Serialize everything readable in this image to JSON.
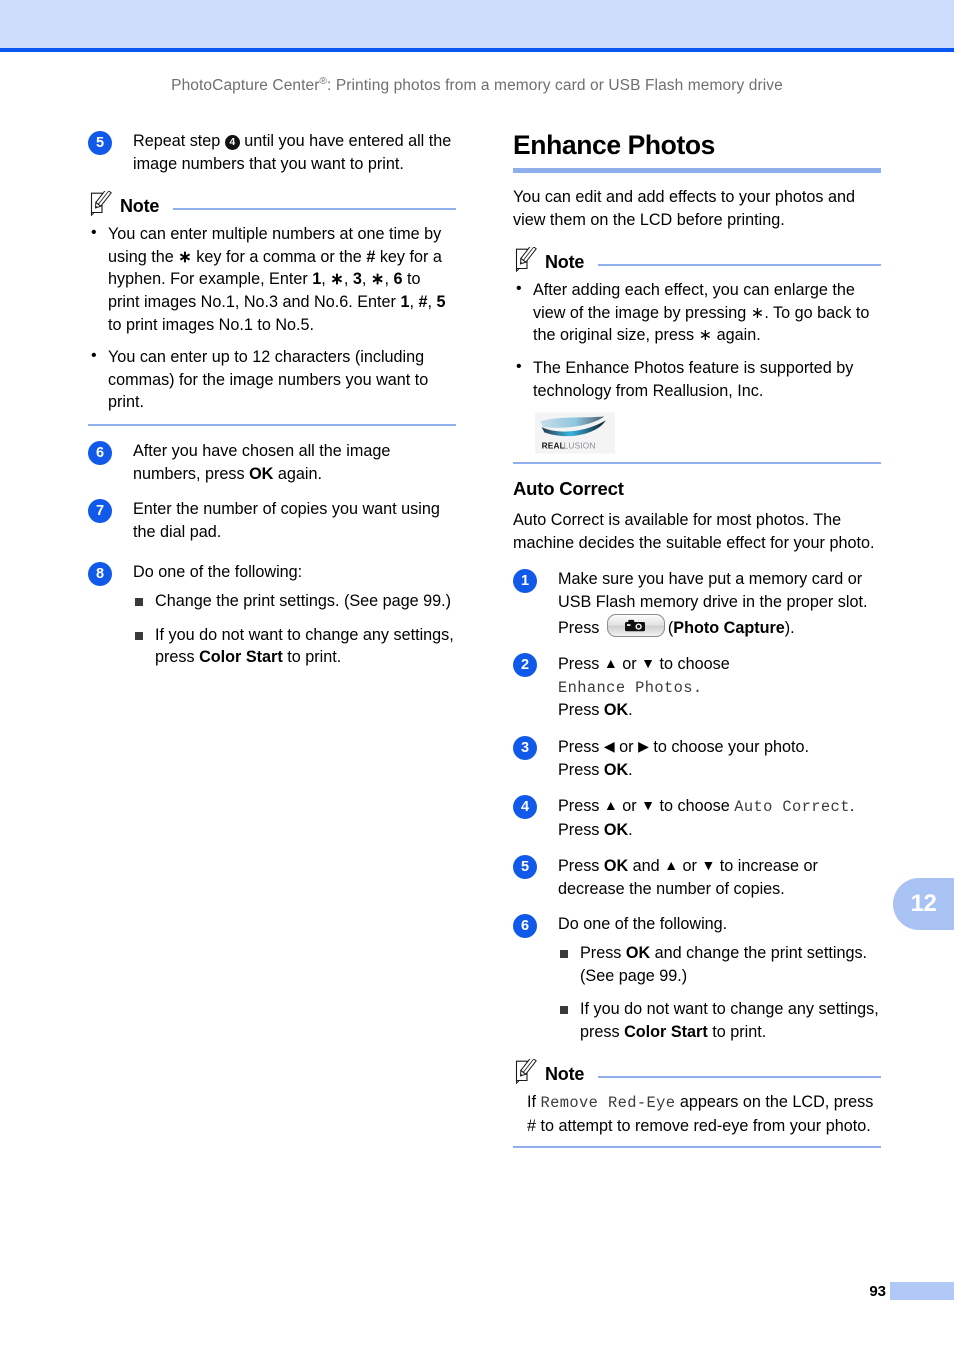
{
  "header": {
    "running_head_prefix": "PhotoCapture Center",
    "running_head_sup": "®",
    "running_head_suffix": ": Printing photos from a memory card or USB Flash memory drive"
  },
  "colors": {
    "band": "#cddcfb",
    "rule": "#0a56f0",
    "accent_rule": "#8fb0ec",
    "step_badge": "#1159e8",
    "chapter_tab": "#a8c2f4",
    "folio_bar": "#b2c8f7"
  },
  "left_column": {
    "step5": {
      "number": "5",
      "text_before": "Repeat step",
      "inline_badge": "4",
      "text_after": "until you have entered all the image numbers that you want to print."
    },
    "note1": {
      "title": "Note",
      "bullets": [
        {
          "p1": "You can enter multiple numbers at one time by using the ",
          "k1": "∗",
          "p2": " key for a comma or the ",
          "k2": "#",
          "p3": " key for a hyphen. For example, Enter ",
          "k3": "1",
          "p4": ", ",
          "k4": "∗",
          "p5": ", ",
          "k5": "3",
          "p6": ", ",
          "k6": "∗",
          "p7": ", ",
          "k7": "6",
          "p8": " to print images No.1, No.3 and No.6. Enter ",
          "k8": "1",
          "p9": ", ",
          "k9": "#",
          "p10": ", ",
          "k10": "5",
          "p11": " to print images No.1 to No.5."
        },
        {
          "text": "You can enter up to 12 characters (including commas) for the image numbers you want to print."
        }
      ]
    },
    "step6": {
      "number": "6",
      "text_before": "After you have chosen all the image numbers, press ",
      "bold": "OK",
      "text_after": " again."
    },
    "step7": {
      "number": "7",
      "text": "Enter the number of copies you want using the dial pad."
    },
    "step8": {
      "number": "8",
      "text": "Do one of the following:",
      "bullets": [
        {
          "text": "Change the print settings. (See page 99.)"
        },
        {
          "text_before": "If you do not want to change any settings, press ",
          "bold": "Color Start",
          "text_after": " to print."
        }
      ]
    }
  },
  "right_column": {
    "heading": "Enhance Photos",
    "intro": "You can edit and add effects to your photos and view them on the LCD before printing.",
    "note1": {
      "title": "Note",
      "bullets": [
        {
          "p1": "After adding each effect, you can enlarge the view of the image by pressing ",
          "k1": "∗",
          "p2": ". To go back to the original size, press ",
          "k2": "∗",
          "p3": " again."
        },
        {
          "text": "The Enhance Photos feature is supported by technology from Reallusion, Inc."
        }
      ],
      "logo": {
        "name": "reallusion-logo",
        "word_bold": "REAL",
        "word_light": "LUSION"
      }
    },
    "subheading": "Auto Correct",
    "sub_intro": "Auto Correct is available for most photos. The machine decides the suitable effect for your photo.",
    "step1": {
      "number": "1",
      "text": "Make sure you have put a memory card or USB Flash memory drive in the proper slot.",
      "press_label": "Press",
      "key_icon": "camera-icon",
      "key_caption_open": "(",
      "key_caption_bold": "Photo Capture",
      "key_caption_close": ")."
    },
    "step2": {
      "number": "2",
      "line1_before": "Press ",
      "up": "▲",
      "or": " or ",
      "down": "▼",
      "line1_after": " to choose",
      "lcd": "Enhance Photos.",
      "line3_before": "Press ",
      "line3_bold": "OK",
      "line3_after": "."
    },
    "step3": {
      "number": "3",
      "line1_before": "Press ",
      "left": "◀",
      "or": " or ",
      "right": "▶",
      "line1_after": " to choose your photo.",
      "line2_before": "Press ",
      "line2_bold": "OK",
      "line2_after": "."
    },
    "step4": {
      "number": "4",
      "line1_before": "Press ",
      "up": "▲",
      "or": " or ",
      "down": "▼",
      "line1_mid": " to choose ",
      "lcd": "Auto Correct",
      "line1_after": ".",
      "line2_before": "Press ",
      "line2_bold": "OK",
      "line2_after": "."
    },
    "step5": {
      "number": "5",
      "t1": "Press ",
      "b1": "OK",
      "t2": " and ",
      "up": "▲",
      "t3": " or ",
      "down": "▼",
      "t4": " to increase or decrease the number of copies."
    },
    "step6": {
      "number": "6",
      "text": "Do one of the following.",
      "bullets": [
        {
          "text_before": "Press ",
          "bold": "OK",
          "text_after": " and change the print settings. (See page 99.)"
        },
        {
          "text_before": "If you do not want to change any settings, press ",
          "bold": "Color Start",
          "text_after": " to print."
        }
      ]
    },
    "note2": {
      "title": "Note",
      "p_before": "If ",
      "lcd": "Remove Red-Eye",
      "p_after": " appears on the LCD, press # to attempt to remove red-eye from your photo."
    }
  },
  "chapter_tab": "12",
  "folio": "93"
}
